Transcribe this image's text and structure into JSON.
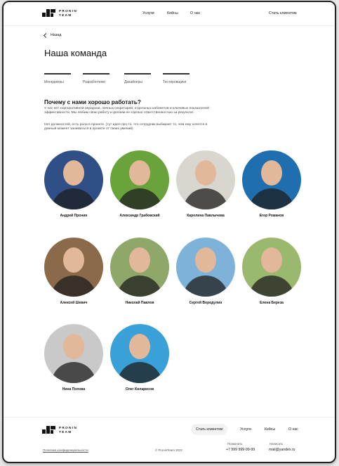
{
  "header": {
    "logo_line1": "PRONIN",
    "logo_line2": "TEAM",
    "nav": [
      "Услуги",
      "Кейсы",
      "О нас"
    ],
    "cta": "Стать клиентом"
  },
  "back_label": "Назад",
  "title": "Наша команда",
  "tabs": [
    "Менеджеры",
    "Разработчики",
    "Дизайнеры",
    "Тестировщики"
  ],
  "why": {
    "title": "Почему с нами хорошо работать?",
    "p1": "У нас нет корпоративной иерархии, личных секретарей, отдельных кабинетов и ключевых показателей эффективности. Мы любим свою работу и делаем ее хорошо ответственностью за результат.",
    "p2": "Нет должностей, есть роли в проекте. (тут идея про то, что сотрудник выбирает то, чем ему хочется в данный момент заниматься в проекте от своих умений)"
  },
  "team": [
    {
      "name": "Андрей Пронин",
      "bg": "#2f4f86"
    },
    {
      "name": "Александр Грабовский",
      "bg": "#6aa33c"
    },
    {
      "name": "Каролина Павлычева",
      "bg": "#d9d6cf"
    },
    {
      "name": "Егор Романов",
      "bg": "#1f6fb0"
    },
    {
      "name": "Алексей Шевич",
      "bg": "#8a6a4a"
    },
    {
      "name": "Николай Павлов",
      "bg": "#8fa86a"
    },
    {
      "name": "Сергей Вородулин",
      "bg": "#7fb2d9"
    },
    {
      "name": "Елена Береза",
      "bg": "#9ab86e"
    },
    {
      "name": "Нина Попова",
      "bg": "#c9c9c9"
    },
    {
      "name": "Олег Киларисов",
      "bg": "#3aa0d8"
    }
  ],
  "footer": {
    "nav": [
      "Стать клиентом",
      "Услуги",
      "Кейсы",
      "О нас"
    ],
    "call_label": "Позвонить",
    "phone": "+7 999 999-99-99",
    "write_label": "Написать",
    "email": "mail@yandex.ru",
    "privacy": "Политика конфиденциальности",
    "copyright": "© ProninTeam 2022"
  }
}
